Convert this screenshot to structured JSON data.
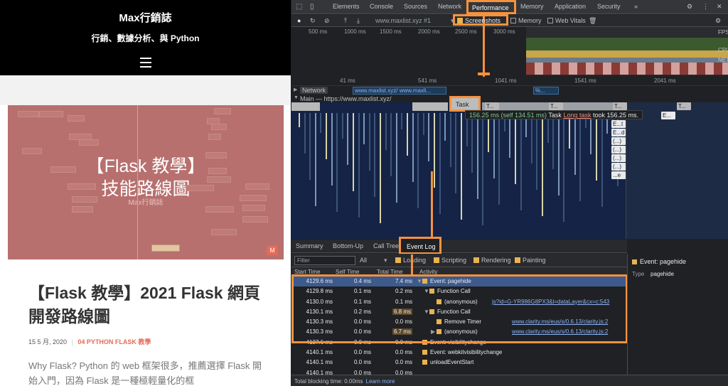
{
  "blog": {
    "title": "Max行銷誌",
    "tagline": "行銷、數據分析、與 Python",
    "featured_title": "【Flask 教學】\n技能路線圖",
    "featured_sub": "Max行銷誌",
    "featured_badge": "M",
    "post_title": "【Flask 教學】2021 Flask 網頁開發路線圖",
    "date": "15 5 月, 2020",
    "category": "04 PYTHON FLASK 教學",
    "excerpt": "Why Flask? Python 的 web 框架很多，推薦選擇 Flask 開始入門，因為 Flask 是一種極輕量化的框"
  },
  "devtools": {
    "tabs": [
      "Elements",
      "Console",
      "Sources",
      "Network",
      "Performance",
      "Memory",
      "Application",
      "Security",
      "»"
    ],
    "active_tab": "Performance",
    "url": "www.maxlist.xyz #1",
    "toolbar_checks": [
      {
        "label": "Screenshots",
        "checked": true
      },
      {
        "label": "Memory",
        "checked": false
      },
      {
        "label": "Web Vitals",
        "checked": false
      }
    ],
    "overview_ticks": [
      "500 ms",
      "1000 ms",
      "1500 ms",
      "2000 ms",
      "2500 ms",
      "3000 ms",
      "41 ms",
      "541 ms",
      "1041 ms",
      "1541 ms",
      "2041 ms"
    ],
    "overview_labels": [
      "FPS",
      "CPU",
      "NET"
    ],
    "flame_ticks": [
      "41 ms",
      "541 ms",
      "1041 ms",
      "1541 ms",
      "2041 ms"
    ],
    "network_label": "Network",
    "network_bars": [
      "www.maxlist.xyz/",
      "www.maxli...",
      "%..."
    ],
    "main_label": "Main — https://www.maxlist.xyz/",
    "task_label": "Task",
    "tooltip": {
      "time": "156.25 ms (self 134.51 ms)",
      "name": "Task",
      "warn": "Long task",
      "rest": "took 156.25 ms."
    },
    "right_flame_items": [
      "E...",
      "E...t",
      "E...d",
      "(...)",
      "(...)",
      "(...)",
      "(...)",
      "...e",
      "T...",
      "T...",
      "T...",
      "T..."
    ],
    "bottom_tabs": [
      "Summary",
      "Bottom-Up",
      "Call Tree",
      "Event Log"
    ],
    "active_bottom_tab": "Event Log",
    "filter_placeholder": "Filter",
    "filter_select": "All",
    "filter_checks": [
      {
        "label": "Loading",
        "checked": true
      },
      {
        "label": "Scripting",
        "checked": true
      },
      {
        "label": "Rendering",
        "checked": true
      },
      {
        "label": "Painting",
        "checked": true
      }
    ],
    "columns": [
      "Start Time",
      "Self Time",
      "Total Time",
      "Activity"
    ],
    "rows": [
      {
        "start": "4129.6 ms",
        "self": "0.4 ms",
        "total": "7.4 ms",
        "expand": "▼",
        "indent": 0,
        "activity": "Event: pagehide",
        "link": ""
      },
      {
        "start": "4129.8 ms",
        "self": "0.1 ms",
        "total": "0.2 ms",
        "expand": "▼",
        "indent": 1,
        "activity": "Function Call",
        "link": ""
      },
      {
        "start": "4130.0 ms",
        "self": "0.1 ms",
        "total": "0.1 ms",
        "expand": "",
        "indent": 2,
        "activity": "(anonymous)",
        "link": "js?id=G-YR986G8PX3&l=dataLayer&cx=c:543"
      },
      {
        "start": "4130.1 ms",
        "self": "0.2 ms",
        "total": "6.8 ms",
        "expand": "▼",
        "indent": 1,
        "activity": "Function Call",
        "link": ""
      },
      {
        "start": "4130.3 ms",
        "self": "0.0 ms",
        "total": "0.0 ms",
        "expand": "",
        "indent": 2,
        "activity": "Remove Timer",
        "link": "www.clarity.ms/eus/s/0.6.13/clarity.js:2"
      },
      {
        "start": "4130.3 ms",
        "self": "0.0 ms",
        "total": "6.7 ms",
        "expand": "▶",
        "indent": 2,
        "activity": "(anonymous)",
        "link": "www.clarity.ms/eus/s/0.6.13/clarity.js:2"
      },
      {
        "start": "4137.6 ms",
        "self": "0.0 ms",
        "total": "0.0 ms",
        "expand": "",
        "indent": 0,
        "activity": "Event: visibilitychange",
        "link": ""
      },
      {
        "start": "4140.1 ms",
        "self": "0.0 ms",
        "total": "0.0 ms",
        "expand": "",
        "indent": 0,
        "activity": "Event: webkitvisibilitychange",
        "link": ""
      },
      {
        "start": "4140.1 ms",
        "self": "0.0 ms",
        "total": "0.0 ms",
        "expand": "",
        "indent": 0,
        "activity": "unloadEventStart",
        "link": ""
      },
      {
        "start": "4140.1 ms",
        "self": "0.0 ms",
        "total": "0.0 ms",
        "expand": "",
        "indent": 0,
        "activity": "",
        "link": ""
      }
    ],
    "side_title": "Event: pagehide",
    "side_type_label": "Type",
    "side_type_value": "pagehide",
    "footer_text": "Total blocking time: 0.00ms",
    "footer_link": "Learn more",
    "highlight_color": "#f5923e"
  }
}
